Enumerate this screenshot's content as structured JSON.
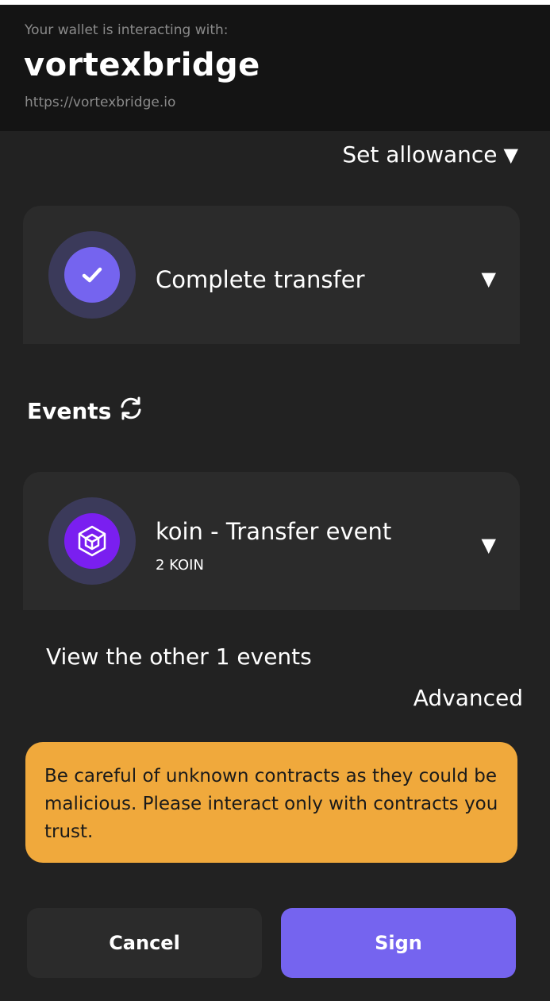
{
  "header": {
    "subtitle": "Your wallet is interacting with:",
    "site_name": "vortexbridge",
    "url": "https://vortexbridge.io"
  },
  "allowance": {
    "label": "Set allowance",
    "icon": "caret-down-icon"
  },
  "operation": {
    "title": "Complete transfer",
    "icon": "check-icon",
    "accent": "#7564ef"
  },
  "events": {
    "heading": "Events",
    "refresh_icon": "refresh-icon",
    "items": [
      {
        "title": "koin - Transfer event",
        "amount": "2 KOIN",
        "icon": "cube-icon",
        "accent": "#7a1ff0"
      }
    ],
    "view_other": "View the other 1 events"
  },
  "advanced_label": "Advanced",
  "warning": {
    "text": "Be careful of unknown contracts as they could be malicious. Please interact only with contracts you trust.",
    "color": "#f0a93c"
  },
  "buttons": {
    "cancel": "Cancel",
    "sign": "Sign",
    "sign_color": "#7564ef"
  }
}
